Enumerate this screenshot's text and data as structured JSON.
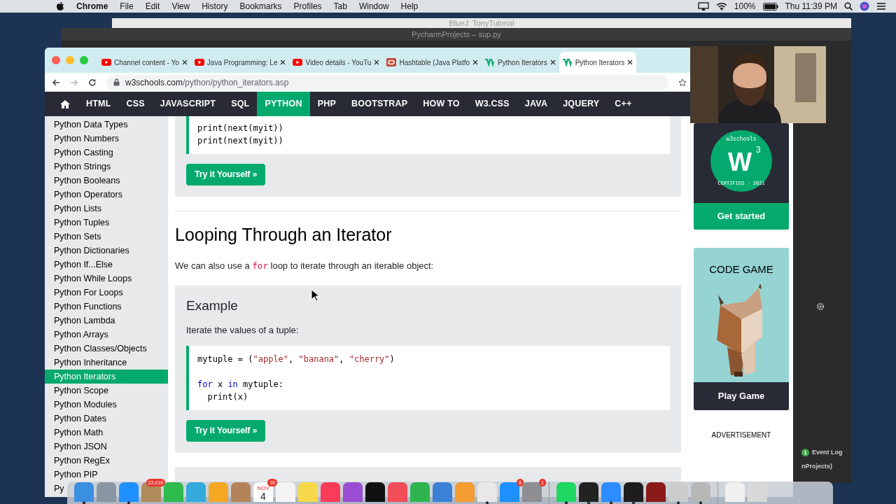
{
  "menu_bar": {
    "app": "Chrome",
    "items": [
      "File",
      "Edit",
      "View",
      "History",
      "Bookmarks",
      "Profiles",
      "Tab",
      "Window",
      "Help"
    ],
    "battery": "100%",
    "clock": "Thu 11:39 PM"
  },
  "back_windows": [
    {
      "kind": "light",
      "title": "BlueJ:  TonyTutorial"
    },
    {
      "kind": "dark",
      "title": "PycharmProjects – sup.py"
    }
  ],
  "ide_panel": {
    "event_count": "1",
    "event_label": "Event Log",
    "path": "nProjects)"
  },
  "browser": {
    "tabs": [
      {
        "kind": "youtube",
        "title": "Channel content - Yo",
        "selected": false
      },
      {
        "kind": "youtube",
        "title": "Java Programming: Le",
        "selected": false
      },
      {
        "kind": "youtube",
        "title": "Video details - YouTu",
        "selected": false
      },
      {
        "kind": "oracle",
        "title": "Hashtable (Java Platfo",
        "selected": false
      },
      {
        "kind": "w3",
        "title": "Python Iterators",
        "selected": false
      },
      {
        "kind": "w3",
        "title": "Python Iterators",
        "selected": true
      }
    ],
    "url_host": "w3schools.com",
    "url_path": "/python/python_iterators.asp"
  },
  "site_nav": [
    {
      "label": "HTML",
      "selected": false
    },
    {
      "label": "CSS",
      "selected": false
    },
    {
      "label": "JAVASCRIPT",
      "selected": false
    },
    {
      "label": "SQL",
      "selected": false
    },
    {
      "label": "PYTHON",
      "selected": true
    },
    {
      "label": "PHP",
      "selected": false
    },
    {
      "label": "BOOTSTRAP",
      "selected": false
    },
    {
      "label": "HOW TO",
      "selected": false
    },
    {
      "label": "W3.CSS",
      "selected": false
    },
    {
      "label": "JAVA",
      "selected": false
    },
    {
      "label": "JQUERY",
      "selected": false
    },
    {
      "label": "C++",
      "selected": false
    }
  ],
  "sidebar": {
    "items": [
      {
        "label": "Python Data Types",
        "selected": false
      },
      {
        "label": "Python Numbers",
        "selected": false
      },
      {
        "label": "Python Casting",
        "selected": false
      },
      {
        "label": "Python Strings",
        "selected": false
      },
      {
        "label": "Python Booleans",
        "selected": false
      },
      {
        "label": "Python Operators",
        "selected": false
      },
      {
        "label": "Python Lists",
        "selected": false
      },
      {
        "label": "Python Tuples",
        "selected": false
      },
      {
        "label": "Python Sets",
        "selected": false
      },
      {
        "label": "Python Dictionaries",
        "selected": false
      },
      {
        "label": "Python If...Else",
        "selected": false
      },
      {
        "label": "Python While Loops",
        "selected": false
      },
      {
        "label": "Python For Loops",
        "selected": false
      },
      {
        "label": "Python Functions",
        "selected": false
      },
      {
        "label": "Python Lambda",
        "selected": false
      },
      {
        "label": "Python Arrays",
        "selected": false
      },
      {
        "label": "Python Classes/Objects",
        "selected": false
      },
      {
        "label": "Python Inheritance",
        "selected": false
      },
      {
        "label": "Python Iterators",
        "selected": true
      },
      {
        "label": "Python Scope",
        "selected": false
      },
      {
        "label": "Python Modules",
        "selected": false
      },
      {
        "label": "Python Dates",
        "selected": false
      },
      {
        "label": "Python Math",
        "selected": false
      },
      {
        "label": "Python JSON",
        "selected": false
      },
      {
        "label": "Python RegEx",
        "selected": false
      },
      {
        "label": "Python PIP",
        "selected": false
      },
      {
        "label": "Py",
        "selected": false
      }
    ]
  },
  "content": [
    {
      "kind": "example",
      "code": [
        {
          "tokens": [
            {
              "t": "print(next(myit))",
              "kind": "plain"
            }
          ]
        },
        {
          "tokens": [
            {
              "t": "print(next(myit))",
              "kind": "plain"
            }
          ]
        }
      ],
      "button": "Try it Yourself »"
    },
    {
      "kind": "divider"
    },
    {
      "kind": "heading",
      "text": "Looping Through an Iterator"
    },
    {
      "kind": "paragraph",
      "before": "We can also use a ",
      "code": "for",
      "after": " loop to iterate through an iterable object:"
    },
    {
      "kind": "example",
      "title": "Example",
      "intro": "Iterate the values of a tuple:",
      "code": [
        {
          "tokens": [
            {
              "t": "mytuple = (",
              "kind": "plain"
            },
            {
              "t": "\"apple\"",
              "kind": "string"
            },
            {
              "t": ", ",
              "kind": "plain"
            },
            {
              "t": "\"banana\"",
              "kind": "string"
            },
            {
              "t": ", ",
              "kind": "plain"
            },
            {
              "t": "\"cherry\"",
              "kind": "string"
            },
            {
              "t": ")",
              "kind": "plain"
            }
          ]
        },
        {
          "kind": "blank"
        },
        {
          "tokens": [
            {
              "t": "for",
              "kind": "keyword"
            },
            {
              "t": " x ",
              "kind": "plain"
            },
            {
              "t": "in",
              "kind": "keyword"
            },
            {
              "t": " mytuple:",
              "kind": "plain"
            }
          ]
        },
        {
          "tokens": [
            {
              "t": "  print(x)",
              "kind": "plain"
            }
          ]
        }
      ],
      "button": "Try it Yourself »"
    },
    {
      "kind": "example_stub"
    }
  ],
  "ads": {
    "certificate": {
      "brand": "w3schools",
      "mark": "W",
      "power": "3",
      "caption": "CERTIFIED · 2021",
      "button": "Get started"
    },
    "game": {
      "title": "CODE GAME",
      "button": "Play Game"
    },
    "label": "ADVERTISEMENT"
  },
  "dock": [
    {
      "kind": "app",
      "color": "#3b8fe0",
      "running": true
    },
    {
      "kind": "app",
      "color": "#8a96a3",
      "running": false
    },
    {
      "kind": "app",
      "color": "#1e90ff",
      "running": true
    },
    {
      "kind": "app",
      "color": "#b08a5a",
      "running": false,
      "badge": "22,019"
    },
    {
      "kind": "app",
      "color": "#2dbb4e",
      "running": false
    },
    {
      "kind": "app",
      "color": "#34aadc",
      "running": false
    },
    {
      "kind": "app",
      "color": "#f5a623",
      "running": false
    },
    {
      "kind": "app",
      "color": "#b5835a",
      "running": false
    },
    {
      "kind": "calendar",
      "color": "#ffffff",
      "running": false,
      "month": "NOV",
      "day": "4",
      "badge": "16"
    },
    {
      "kind": "app",
      "color": "#f4f4f4",
      "running": false
    },
    {
      "kind": "app",
      "color": "#f7d84a",
      "running": false
    },
    {
      "kind": "app",
      "color": "#fb3c59",
      "running": false
    },
    {
      "kind": "app",
      "color": "#9b4dd3",
      "running": false
    },
    {
      "kind": "app",
      "color": "#111111",
      "running": false
    },
    {
      "kind": "app",
      "color": "#f14e5a",
      "running": false
    },
    {
      "kind": "app",
      "color": "#2fb550",
      "running": false
    },
    {
      "kind": "app",
      "color": "#3b82d6",
      "running": false
    },
    {
      "kind": "app",
      "color": "#f39c32",
      "running": false
    },
    {
      "kind": "app",
      "color": "#e8e8e8",
      "running": true
    },
    {
      "kind": "app",
      "color": "#1e90ff",
      "running": false,
      "badge": "8"
    },
    {
      "kind": "app",
      "color": "#8e8e93",
      "running": false,
      "badge": "1"
    },
    {
      "kind": "separator"
    },
    {
      "kind": "app",
      "color": "#1ed760",
      "running": true
    },
    {
      "kind": "app",
      "color": "#222222",
      "running": true
    },
    {
      "kind": "app",
      "color": "#2d8cff",
      "running": true
    },
    {
      "kind": "app",
      "color": "#1d1d1d",
      "running": true
    },
    {
      "kind": "app",
      "color": "#8b1a1a",
      "running": false
    },
    {
      "kind": "app",
      "color": "#cccccc",
      "running": true
    },
    {
      "kind": "app",
      "color": "#b7b7b7",
      "running": true
    },
    {
      "kind": "separator"
    },
    {
      "kind": "app",
      "color": "#f0f0f0",
      "running": false
    },
    {
      "kind": "app",
      "color": "#d8d8d8",
      "running": false
    }
  ]
}
